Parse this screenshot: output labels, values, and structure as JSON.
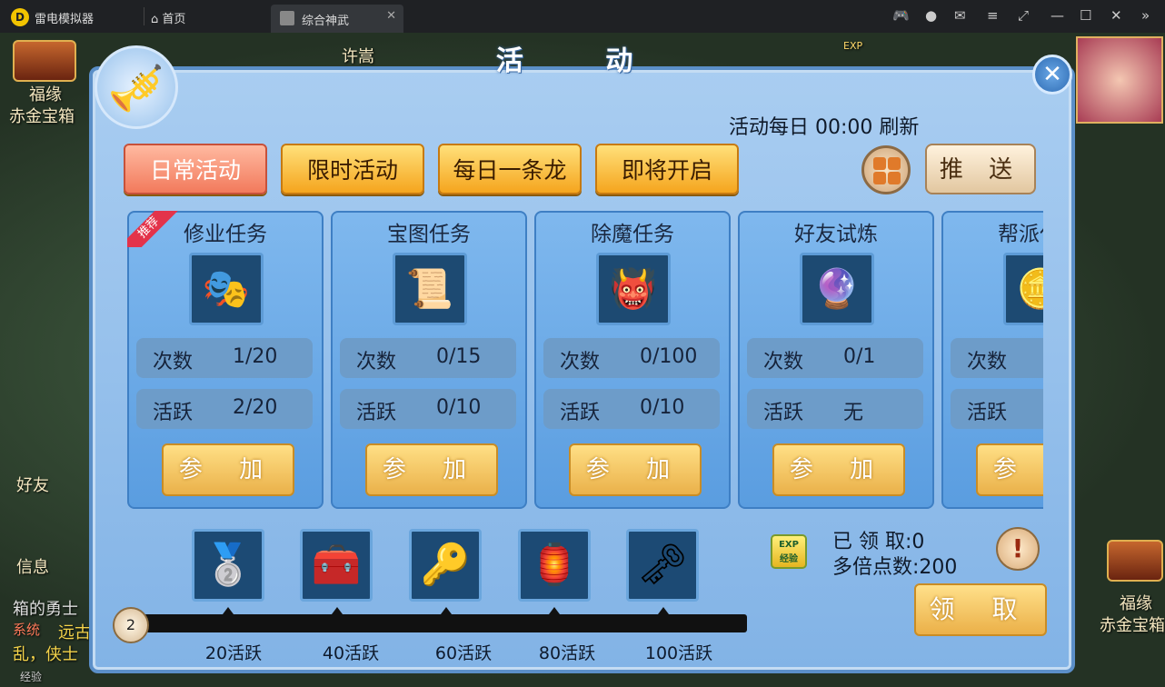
{
  "window": {
    "app_name": "雷电模拟器",
    "home_label": "首页",
    "tab_label": "综合神武"
  },
  "background": {
    "left_chest_line1": "福缘",
    "left_chest_line2": "赤金宝箱",
    "top_name": "许嵩",
    "exp_badge": "EXP",
    "friends": "好友",
    "messages": "信息",
    "chat_line1": "箱的勇士",
    "chat_system": "系统",
    "chat_line2": "远古",
    "chat_line3": "乱，侠士",
    "right_chest_line1": "福缘",
    "right_chest_line2": "赤金宝箱",
    "exp_bar_label": "经验"
  },
  "panel": {
    "title": "活 动",
    "refresh_text": "活动每日 00:00 刷新",
    "tabs": [
      {
        "label": "日常活动",
        "active": true
      },
      {
        "label": "限时活动",
        "active": false
      },
      {
        "label": "每日一条龙",
        "active": false
      },
      {
        "label": "即将开启",
        "active": false
      }
    ],
    "push_label": "推 送",
    "close_symbol": "✕",
    "horn_icon": "🎺"
  },
  "activities": [
    {
      "title": "修业任务",
      "icon": "🎭",
      "count_label": "次数",
      "count": "1/20",
      "active_label": "活跃",
      "active": "2/20",
      "join": "参 加",
      "recommended": "推荐"
    },
    {
      "title": "宝图任务",
      "icon": "📜",
      "count_label": "次数",
      "count": "0/15",
      "active_label": "活跃",
      "active": "0/10",
      "join": "参 加"
    },
    {
      "title": "除魔任务",
      "icon": "👹",
      "count_label": "次数",
      "count": "0/100",
      "active_label": "活跃",
      "active": "0/10",
      "join": "参 加"
    },
    {
      "title": "好友试炼",
      "icon": "🔮",
      "count_label": "次数",
      "count": "0/1",
      "active_label": "活跃",
      "active": "无",
      "join": "参 加"
    },
    {
      "title": "帮派任务",
      "icon": "🪙",
      "count_label": "次数",
      "count": "",
      "active_label": "活跃",
      "active": "",
      "join": "参 加"
    }
  ],
  "rewards": {
    "items": [
      {
        "icon": "🥈",
        "milestone": "20活跃"
      },
      {
        "icon": "🧰",
        "milestone": "40活跃"
      },
      {
        "icon": "🔑",
        "milestone": "60活跃"
      },
      {
        "icon": "🏮",
        "milestone": "80活跃"
      },
      {
        "icon": "🗝",
        "milestone": "100活跃"
      }
    ],
    "current_active": "2",
    "exp_icon_text": "EXP",
    "exp_icon_sub": "经验",
    "claimed_label": "已 领 取:0",
    "multiplier_label": "多倍点数:200",
    "warn_symbol": "!",
    "claim_button": "领 取"
  }
}
